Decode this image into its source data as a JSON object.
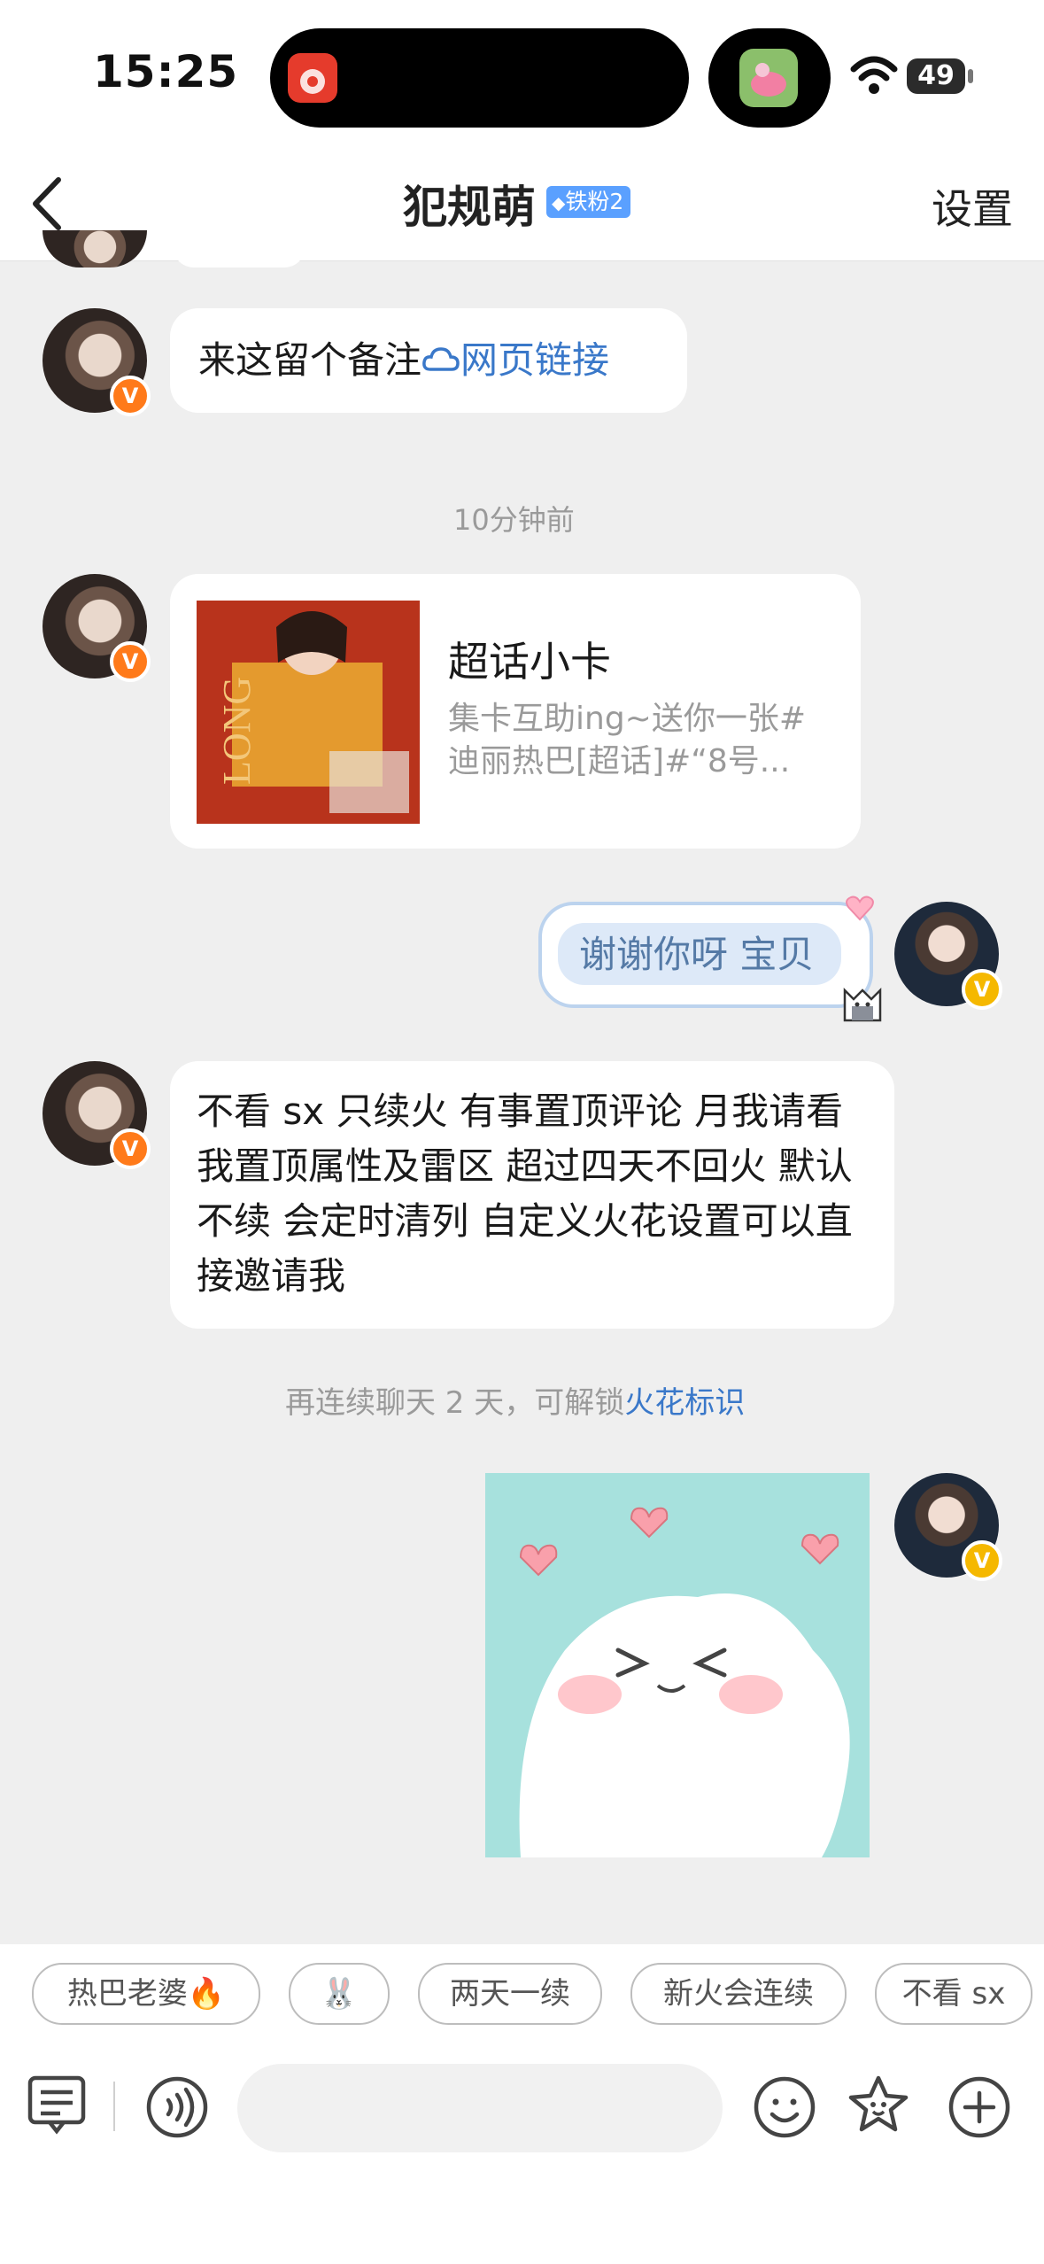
{
  "status_bar": {
    "time": "15:25",
    "battery": "49",
    "icons": [
      "app-icon",
      "app-icon-2",
      "wifi-icon",
      "battery-icon"
    ]
  },
  "header": {
    "title": "犯规萌",
    "badge": "铁粉2",
    "settings_label": "设置",
    "back_icon": "chevron-left-icon"
  },
  "messages": {
    "m1": {
      "text_prefix": "来这留个备注",
      "link_text": "网页链接",
      "icon": "cloud-link-icon"
    },
    "time1": "10分钟前",
    "card": {
      "title": "超话小卡",
      "desc": "集卡互助ing~送你一张#迪丽热巴[超话]#“8号..."
    },
    "mine1": "谢谢你呀 宝贝",
    "m3": "不看 sx 只续火 有事置顶评论 月我请看我置顶属性及雷区 超过四天不回火 默认不续 会定时清列 自定义火花设置可以直接邀请我",
    "notice": {
      "prefix": "再连续聊天 2 天，可解锁",
      "link": "火花标识"
    }
  },
  "quick_replies": [
    "热巴老婆🔥",
    "🐰",
    "两天一续",
    "新火会连续",
    "不看 sx"
  ],
  "input_bar": {
    "icons": [
      "list-icon",
      "voice-icon",
      "emoji-icon",
      "sticker-icon",
      "plus-icon"
    ],
    "placeholder": ""
  },
  "colors": {
    "accent_link": "#3a78c9",
    "badge_bg": "#5aa0ff",
    "verified_orange": "#ff7a1a",
    "verified_yellow": "#f5b800"
  }
}
